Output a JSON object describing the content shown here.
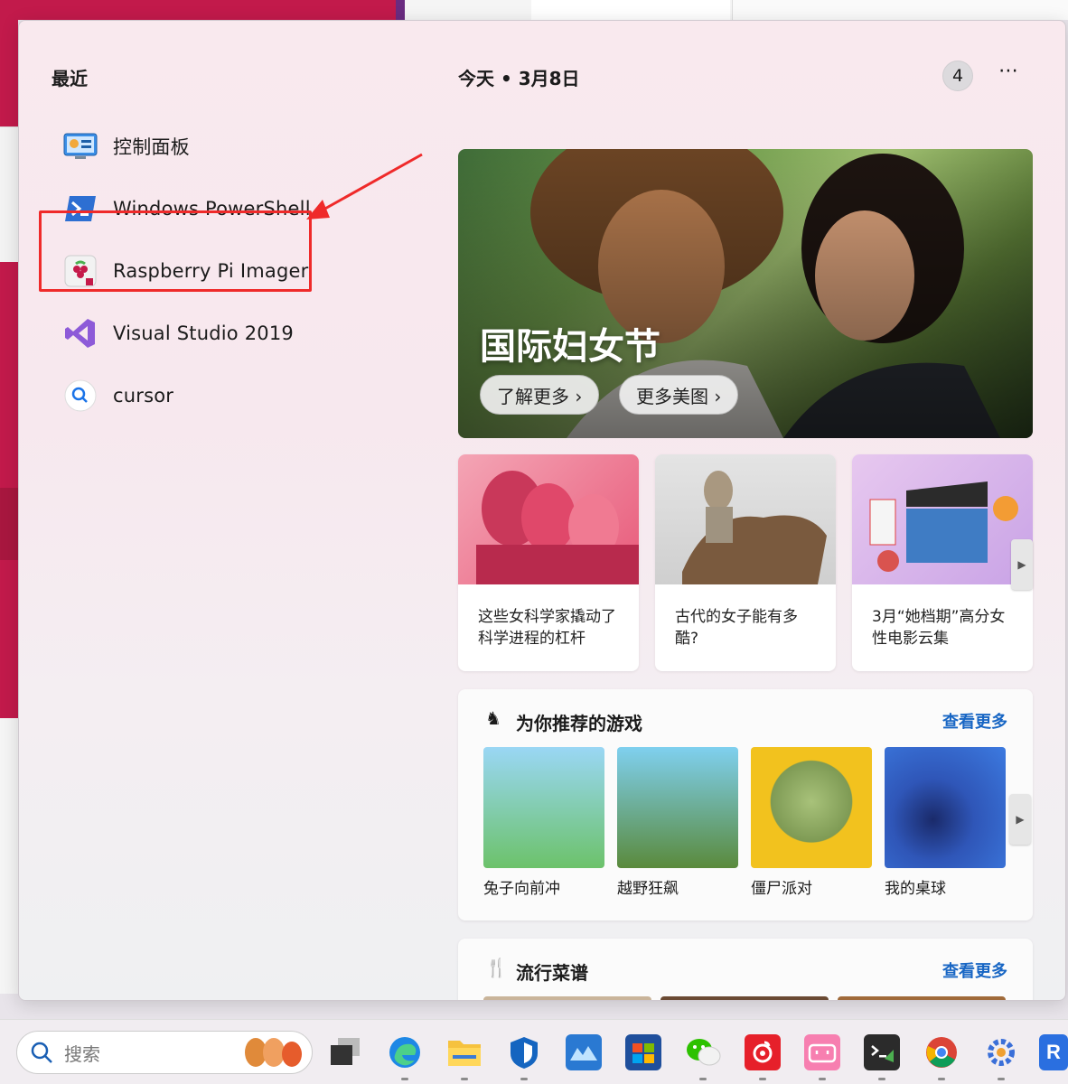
{
  "recent": {
    "title": "最近",
    "items": [
      {
        "label": "控制面板",
        "icon": "control-panel-icon"
      },
      {
        "label": "Windows PowerShell",
        "icon": "powershell-icon"
      },
      {
        "label": "Raspberry Pi Imager",
        "icon": "raspberry-pi-icon"
      },
      {
        "label": "Visual Studio 2019",
        "icon": "visual-studio-icon"
      },
      {
        "label": "cursor",
        "icon": "search-icon"
      }
    ]
  },
  "header": {
    "date": "今天 • 3月8日",
    "badge": "4",
    "more": "⋯"
  },
  "hero": {
    "title": "国际妇女节",
    "btn_learn": "了解更多 ›",
    "btn_images": "更多美图 ›"
  },
  "cards": [
    {
      "caption": "这些女科学家撬动了科学进程的杠杆"
    },
    {
      "caption": "古代的女子能有多酷?"
    },
    {
      "caption": "3月“她档期”高分女性电影云集"
    }
  ],
  "games": {
    "title": "为你推荐的游戏",
    "see_more": "查看更多",
    "items": [
      {
        "label": "兔子向前冲"
      },
      {
        "label": "越野狂飙"
      },
      {
        "label": "僵尸派对"
      },
      {
        "label": "我的桌球"
      }
    ]
  },
  "recipes": {
    "title": "流行菜谱",
    "see_more": "查看更多"
  },
  "taskbar": {
    "search_placeholder": "搜索"
  },
  "colors": {
    "accent": "#1866c4",
    "highlight": "#ef2a2a"
  }
}
